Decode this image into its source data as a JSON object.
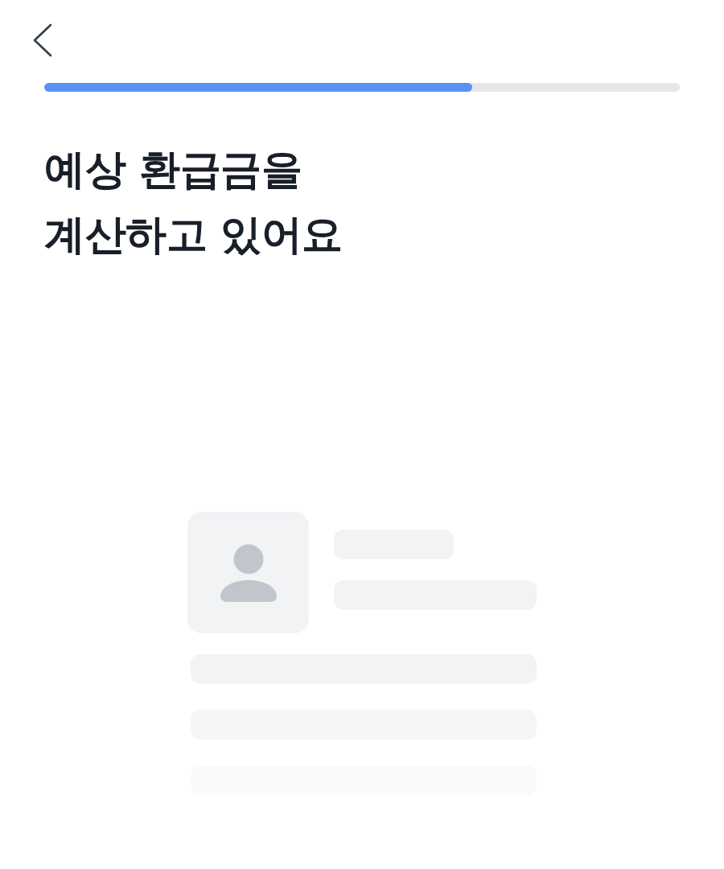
{
  "progress": {
    "level": 0.673
  },
  "title_lines": [
    "예상 환급금을",
    "계산하고 있어요"
  ]
}
